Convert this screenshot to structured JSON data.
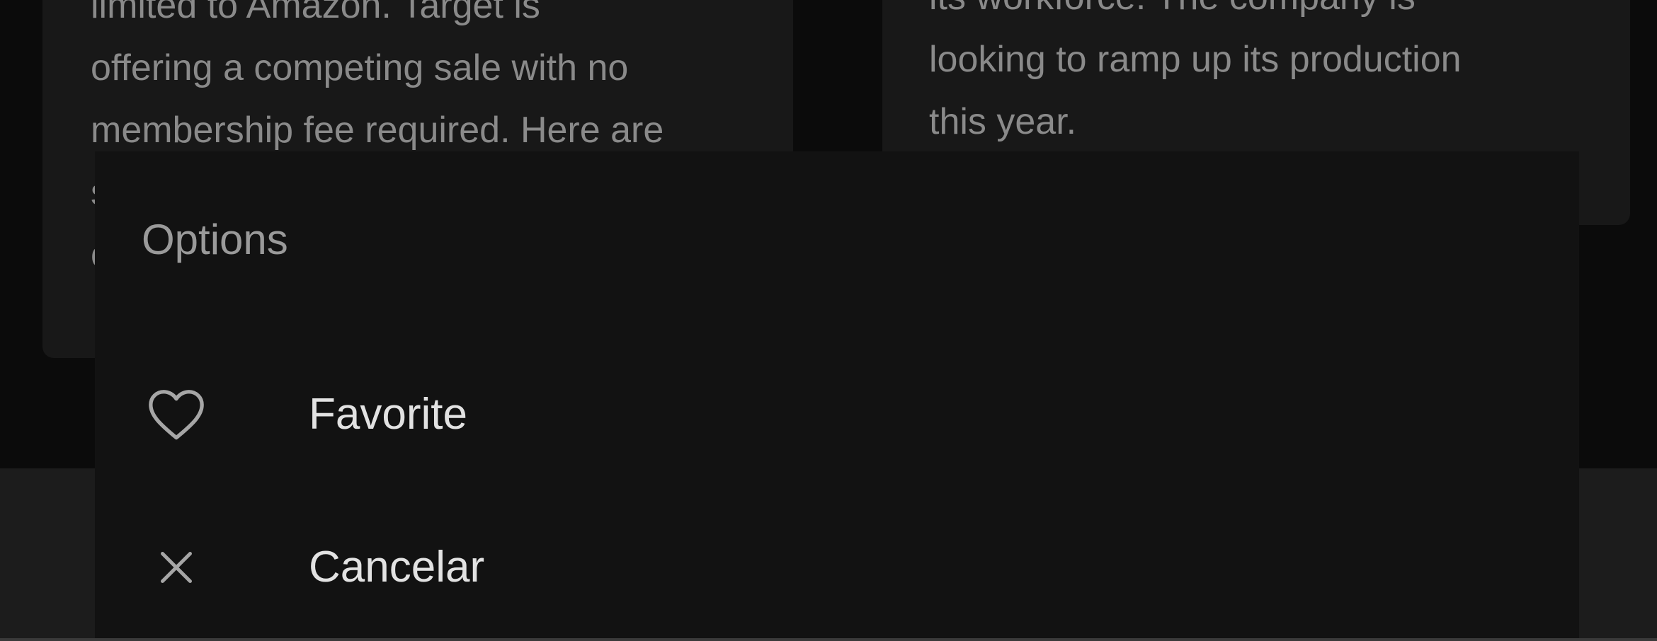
{
  "background_cards": [
    {
      "lines": [
        "limited to Amazon. Target is",
        "offering a competing sale with no",
        "membership fee required. Here are",
        "s",
        "o"
      ]
    },
    {
      "lines": [
        "its workforce. The company is",
        "looking to ramp up its production",
        "this year."
      ]
    }
  ],
  "options_sheet": {
    "title": "Options",
    "items": [
      {
        "label": "Favorite",
        "icon": "heart-outline-icon"
      },
      {
        "label": "Cancelar",
        "icon": "close-icon"
      }
    ]
  },
  "colors": {
    "background": "#0b0b0b",
    "card": "#181818",
    "sheet": "#121212",
    "bottom_bar": "#1c1c1c",
    "muted_text": "#8a8a8a",
    "item_text": "#e2e2e2",
    "icon": "#a6a6a6"
  }
}
